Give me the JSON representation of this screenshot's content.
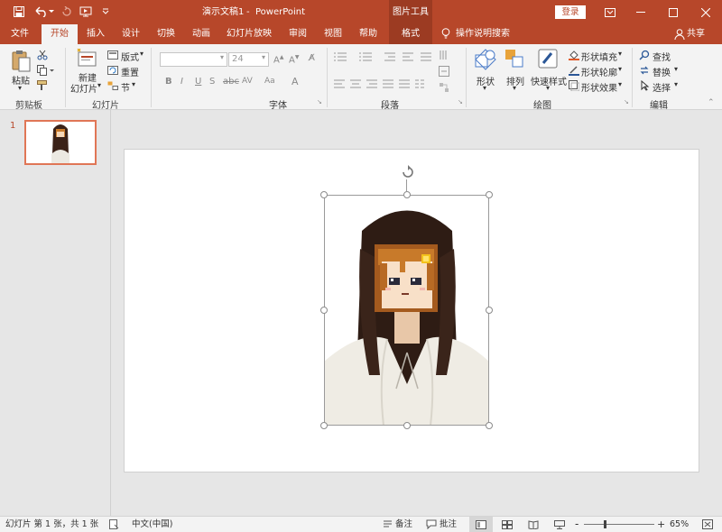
{
  "window": {
    "doc_title": "演示文稿1",
    "separator": "-",
    "app_name": "PowerPoint",
    "context_tab_group": "图片工具",
    "login_label": "登录"
  },
  "tabs": [
    {
      "label": "文件"
    },
    {
      "label": "开始"
    },
    {
      "label": "插入"
    },
    {
      "label": "设计"
    },
    {
      "label": "切换"
    },
    {
      "label": "动画"
    },
    {
      "label": "幻灯片放映"
    },
    {
      "label": "审阅"
    },
    {
      "label": "视图"
    },
    {
      "label": "帮助"
    },
    {
      "label": "格式"
    }
  ],
  "tell_me": "操作说明搜索",
  "share_label": "共享",
  "ribbon": {
    "clipboard": {
      "paste": "粘贴",
      "group": "剪贴板"
    },
    "slides": {
      "new_line1": "新建",
      "new_line2": "幻灯片",
      "layout": "版式",
      "reset": "重置",
      "section": "节",
      "group": "幻灯片"
    },
    "font": {
      "size": "24",
      "group": "字体"
    },
    "paragraph": {
      "group": "段落"
    },
    "drawing": {
      "shapes": "形状",
      "arrange": "排列",
      "quick_styles": "快速样式",
      "fill": "形状填充",
      "outline": "形状轮廓",
      "effects": "形状效果",
      "group": "绘图"
    },
    "editing": {
      "find": "查找",
      "replace": "替换",
      "select": "选择",
      "group": "编辑"
    }
  },
  "thumbnails": [
    {
      "number": "1"
    }
  ],
  "status": {
    "slide_info": "幻灯片 第 1 张，共 1 张",
    "language": "中文(中国)",
    "notes": "备注",
    "comments": "批注",
    "zoom": "65%",
    "zoom_minus": "-",
    "zoom_plus": "+"
  },
  "colors": {
    "accent": "#b7472a",
    "accent_dark": "#9c3b22",
    "ribbon_bg": "#f3f3f3"
  }
}
